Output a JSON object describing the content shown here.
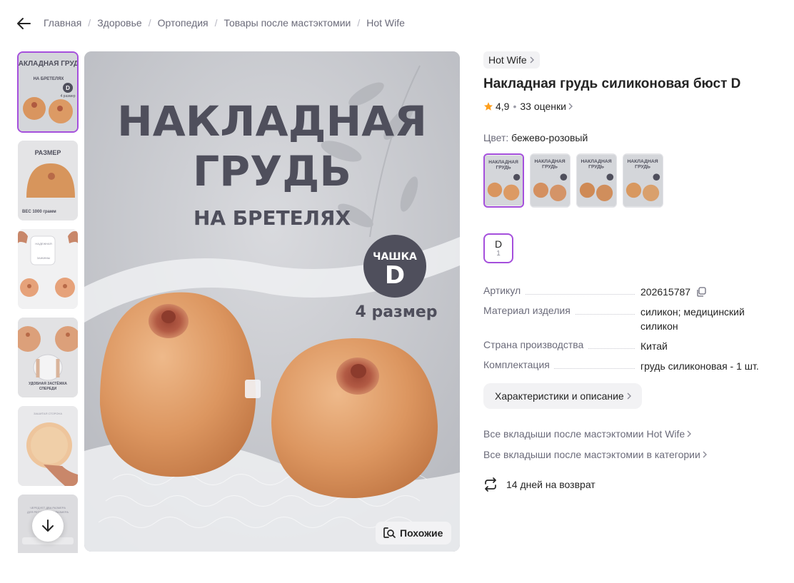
{
  "breadcrumbs": [
    "Главная",
    "Здоровье",
    "Ортопедия",
    "Товары после мастэктомии",
    "Hot Wife"
  ],
  "gallery": {
    "thumbnails": [
      {
        "title": "НАКЛАДНАЯ ГРУДЬ",
        "subtitle": "НА БРЕТЕЛЯХ",
        "badge": "D",
        "note": "4 размер"
      },
      {
        "title": "РАЗМЕР",
        "note": "ВЕС 1000 грамм"
      },
      {
        "title": "НАДЕЖНАЯ ФИКСАЦИЯ",
        "note": "ЗАЖИМЫ НА ЛЕНТАХ"
      },
      {
        "title": "",
        "note": "УДОБНАЯ ЗАСТЁЖКА СПЕРЕДИ"
      },
      {
        "title": "ЗАШИТАЯ СТОРОНА",
        "note": ""
      },
      {
        "title": "ЧЕРЕДУЕТ ДВА РАЗМЕРА ДЛЯ РЕГУЛИРОВКИ РАЗМЕРА",
        "note": ""
      }
    ],
    "main": {
      "headline_1": "НАКЛАДНАЯ",
      "headline_2": "ГРУДЬ",
      "headline_3": "НА БРЕТЕЛЯХ",
      "cup_label": "ЧАШКА",
      "cup_size": "D",
      "size_text": "4 размер"
    },
    "similar_label": "Похожие"
  },
  "product": {
    "brand": "Hot Wife",
    "title": "Накладная грудь силиконовая бюст D",
    "rating": "4,9",
    "reviews": "33 оценки",
    "color_label": "Цвет:",
    "color_value": "бежево-розовый",
    "swatch_count": 4,
    "size": {
      "label": "D",
      "count": "1"
    },
    "specs": [
      {
        "key": "Артикул",
        "value": "202615787"
      },
      {
        "key": "Материал изделия",
        "value": "силикон; медицинский силикон"
      },
      {
        "key": "Страна производства",
        "value": "Китай"
      },
      {
        "key": "Комплектация",
        "value": "грудь силиконовая - 1 шт."
      }
    ],
    "details_button": "Характеристики и описание",
    "link_brand": "Все вкладыши после мастэктомии Hot Wife",
    "link_category": "Все вкладыши после мастэктомии в категории",
    "returns": "14 дней на возврат"
  },
  "colors": {
    "accent": "#a54fdc",
    "star": "#ff9f1c",
    "text": "#242424",
    "muted": "#6b6b7a"
  }
}
